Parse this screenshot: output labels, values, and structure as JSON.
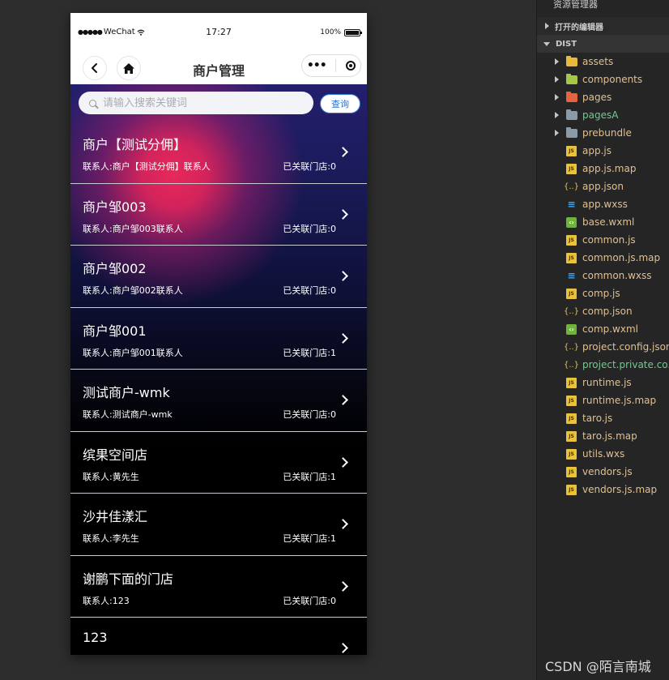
{
  "status_bar": {
    "carrier": "WeChat",
    "time": "17:27",
    "battery": "100%"
  },
  "nav": {
    "title": "商户管理"
  },
  "search": {
    "placeholder": "请输入搜索关键词",
    "value": "",
    "button_label": "查询"
  },
  "merchants": [
    {
      "name": "商户【测试分佣】",
      "contact": "联系人:商户【测试分佣】联系人",
      "stores": "已关联门店:0"
    },
    {
      "name": "商户邹003",
      "contact": "联系人:商户邹003联系人",
      "stores": "已关联门店:0"
    },
    {
      "name": "商户邹002",
      "contact": "联系人:商户邹002联系人",
      "stores": "已关联门店:0"
    },
    {
      "name": "商户邹001",
      "contact": "联系人:商户邹001联系人",
      "stores": "已关联门店:1"
    },
    {
      "name": "测试商户-wmk",
      "contact": "联系人:测试商户-wmk",
      "stores": "已关联门店:0"
    },
    {
      "name": "缤果空间店",
      "contact": "联系人:黄先生",
      "stores": "已关联门店:1"
    },
    {
      "name": "沙井佳漾汇",
      "contact": "联系人:李先生",
      "stores": "已关联门店:1"
    },
    {
      "name": "谢鹏下面的门店",
      "contact": "联系人:123",
      "stores": "已关联门店:0"
    },
    {
      "name": "123",
      "contact": "",
      "stores": ""
    }
  ],
  "explorer": {
    "title": "资源管理器",
    "open_editors": "打开的编辑器",
    "root": "DIST",
    "folders": [
      {
        "name": "assets",
        "color": "#e8b93b"
      },
      {
        "name": "components",
        "color": "#a6c648"
      },
      {
        "name": "pages",
        "color": "#e5643f"
      },
      {
        "name": "pagesA",
        "color": "#8a9aa6"
      },
      {
        "name": "prebundle",
        "color": "#8a9aa6"
      }
    ],
    "files": [
      {
        "name": "app.js",
        "icon": "js-icon"
      },
      {
        "name": "app.js.map",
        "icon": "map-icon"
      },
      {
        "name": "app.json",
        "icon": "json-icon"
      },
      {
        "name": "app.wxss",
        "icon": "wxss-icon"
      },
      {
        "name": "base.wxml",
        "icon": "wxml-icon"
      },
      {
        "name": "common.js",
        "icon": "js-icon"
      },
      {
        "name": "common.js.map",
        "icon": "map-icon"
      },
      {
        "name": "common.wxss",
        "icon": "wxss-icon"
      },
      {
        "name": "comp.js",
        "icon": "js-icon"
      },
      {
        "name": "comp.json",
        "icon": "json-icon"
      },
      {
        "name": "comp.wxml",
        "icon": "wxml-icon"
      },
      {
        "name": "project.config.json",
        "icon": "json-icon"
      },
      {
        "name": "project.private.co...",
        "icon": "json-icon"
      },
      {
        "name": "runtime.js",
        "icon": "js-icon"
      },
      {
        "name": "runtime.js.map",
        "icon": "map-icon"
      },
      {
        "name": "taro.js",
        "icon": "js-icon"
      },
      {
        "name": "taro.js.map",
        "icon": "map-icon"
      },
      {
        "name": "utils.wxs",
        "icon": "js-icon"
      },
      {
        "name": "vendors.js",
        "icon": "js-icon"
      },
      {
        "name": "vendors.js.map",
        "icon": "map-icon"
      }
    ]
  },
  "watermark": "CSDN @陌言南城",
  "icon_glyphs": {
    "js": "JS",
    "json": "{..}",
    "wxss": "≡",
    "wxml": "‹›"
  }
}
